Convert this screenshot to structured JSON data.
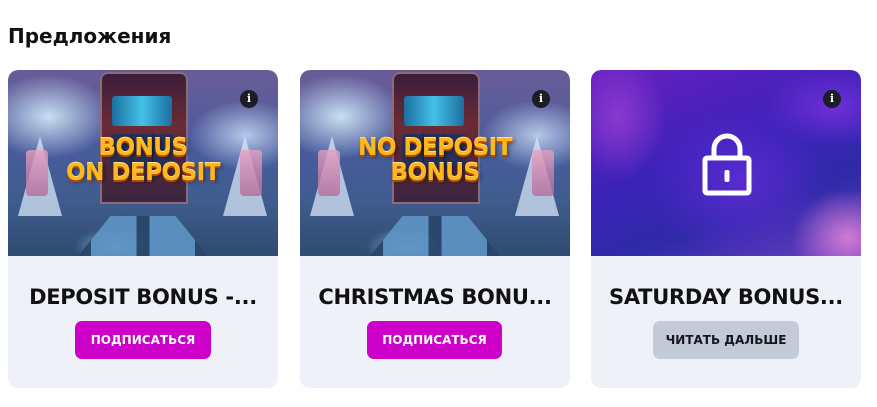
{
  "section": {
    "title": "Предложения"
  },
  "cards": [
    {
      "banner_text": [
        "BONUS",
        "ON DEPOSIT"
      ],
      "title": "DEPOSIT BONUS -...",
      "button": "ПОДПИСАТЬСЯ",
      "info_icon": "i"
    },
    {
      "banner_text": [
        "NO DEPOSIT",
        "BONUS"
      ],
      "title": "CHRISTMAS BONU...",
      "button": "ПОДПИСАТЬСЯ",
      "info_icon": "i"
    },
    {
      "banner_icon": "lock-icon",
      "title": "SATURDAY BONUS...",
      "button": "ЧИТАТЬ ДАЛЬШЕ",
      "info_icon": "i"
    }
  ],
  "colors": {
    "subscribe_button": "#cc00c8",
    "read_more_button": "#c3cad8",
    "card_background": "#eef1f8",
    "promo_text": "#ffb81c"
  }
}
